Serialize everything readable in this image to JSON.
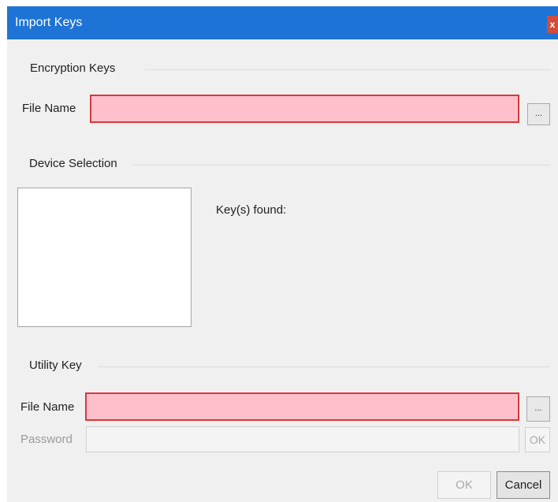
{
  "window": {
    "title": "Import Keys",
    "close_label": "x"
  },
  "encryption_keys": {
    "heading": "Encryption Keys",
    "file_name_label": "File Name",
    "file_name_value": "",
    "browse_label": "..."
  },
  "device_selection": {
    "heading": "Device Selection",
    "keys_found_label": "Key(s) found:"
  },
  "utility_key": {
    "heading": "Utility Key",
    "file_name_label": "File Name",
    "file_name_value": "",
    "browse_label": "...",
    "password_label": "Password",
    "password_value": "",
    "password_ok_label": "OK"
  },
  "footer": {
    "ok_label": "OK",
    "cancel_label": "Cancel"
  },
  "colors": {
    "titlebar": "#1e74d6",
    "close_button": "#d34b3a",
    "error_fill": "#ffc0cb",
    "error_border": "#d9383a"
  }
}
